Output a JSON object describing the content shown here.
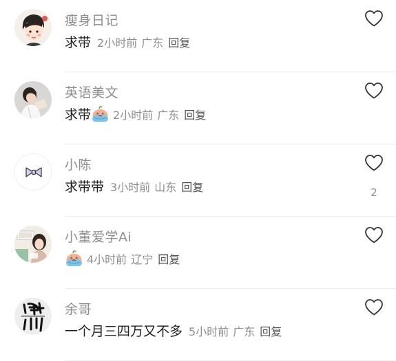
{
  "comments": [
    {
      "username": "瘦身日记",
      "text": "求带",
      "emoji": "",
      "time": "2小时前",
      "location": "广东",
      "reply": "回复",
      "likes": "",
      "avatar": "cartoon-girl-avatar"
    },
    {
      "username": "英语美文",
      "text": "求带",
      "emoji": "crying-bean-emoji",
      "time": "2小时前",
      "location": "广东",
      "reply": "回复",
      "likes": "",
      "avatar": "reading-girl-avatar"
    },
    {
      "username": "小陈",
      "text": "求带带",
      "emoji": "",
      "time": "3小时前",
      "location": "山东",
      "reply": "回复",
      "likes": "2",
      "avatar": "bow-tie-avatar"
    },
    {
      "username": "小董爱学Ai",
      "text": "",
      "emoji": "crying-bean-emoji",
      "time": "4小时前",
      "location": "辽宁",
      "reply": "回复",
      "likes": "",
      "avatar": "photo-girl-avatar"
    },
    {
      "username": "余哥",
      "text": "一个月三四万又不多",
      "emoji": "",
      "time": "5小时前",
      "location": "广东",
      "reply": "回复",
      "likes": "",
      "avatar": "calligraphy-avatar"
    }
  ],
  "colors": {
    "meta": "#8e8e8e",
    "divider": "#ededed"
  }
}
